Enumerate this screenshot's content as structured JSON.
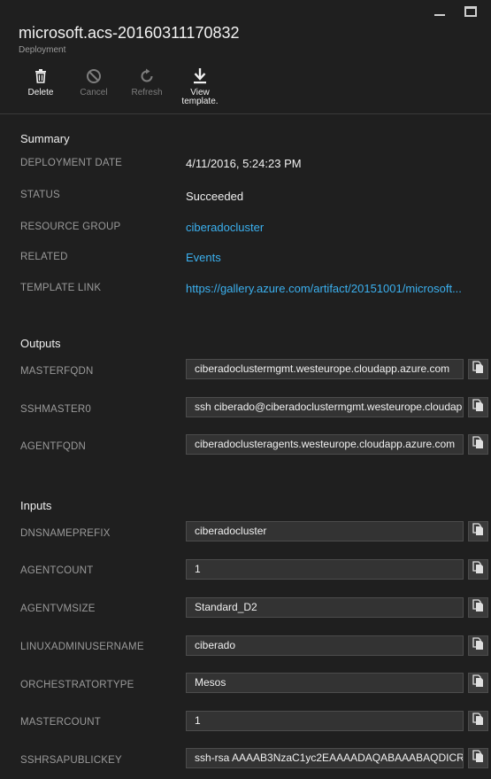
{
  "window": {
    "title": "microsoft.acs-20160311170832",
    "subtitle": "Deployment",
    "minimize_icon": "minimize-icon",
    "maximize_icon": "maximize-icon"
  },
  "toolbar": {
    "items": [
      {
        "label": "Delete",
        "icon": "trash-icon",
        "enabled": true
      },
      {
        "label": "Cancel",
        "icon": "cancel-icon",
        "enabled": false
      },
      {
        "label": "Refresh",
        "icon": "refresh-icon",
        "enabled": false
      },
      {
        "label": "View template.",
        "icon": "download-icon",
        "enabled": true
      }
    ]
  },
  "summary": {
    "title": "Summary",
    "rows": [
      {
        "label": "DEPLOYMENT DATE",
        "value": "4/11/2016, 5:24:23 PM",
        "link": false
      },
      {
        "label": "STATUS",
        "value": "Succeeded",
        "link": false
      },
      {
        "label": "RESOURCE GROUP",
        "value": "ciberadocluster",
        "link": true
      },
      {
        "label": "RELATED",
        "value": "Events",
        "link": true
      },
      {
        "label": "TEMPLATE LINK",
        "value": "https://gallery.azure.com/artifact/20151001/microsoft...",
        "link": true
      }
    ]
  },
  "outputs": {
    "title": "Outputs",
    "rows": [
      {
        "label": "MASTERFQDN",
        "value": "ciberadoclustermgmt.westeurope.cloudapp.azure.com"
      },
      {
        "label": "SSHMASTER0",
        "value": "ssh ciberado@ciberadoclustermgmt.westeurope.cloudap"
      },
      {
        "label": "AGENTFQDN",
        "value": "ciberadoclusteragents.westeurope.cloudapp.azure.com"
      }
    ]
  },
  "inputs": {
    "title": "Inputs",
    "rows": [
      {
        "label": "DNSNAMEPREFIX",
        "value": "ciberadocluster"
      },
      {
        "label": "AGENTCOUNT",
        "value": "1"
      },
      {
        "label": "AGENTVMSIZE",
        "value": "Standard_D2"
      },
      {
        "label": "LINUXADMINUSERNAME",
        "value": "ciberado"
      },
      {
        "label": "ORCHESTRATORTYPE",
        "value": "Mesos"
      },
      {
        "label": "MASTERCOUNT",
        "value": "1"
      },
      {
        "label": "SSHRSAPUBLICKEY",
        "value": "ssh-rsa AAAAB3NzaC1yc2EAAAADAQABAAABAQDICRD"
      }
    ]
  },
  "colors": {
    "background": "#1f1f1f",
    "link": "#3bb0ef",
    "muted": "#9a9a9a",
    "field_bg": "#333333"
  }
}
